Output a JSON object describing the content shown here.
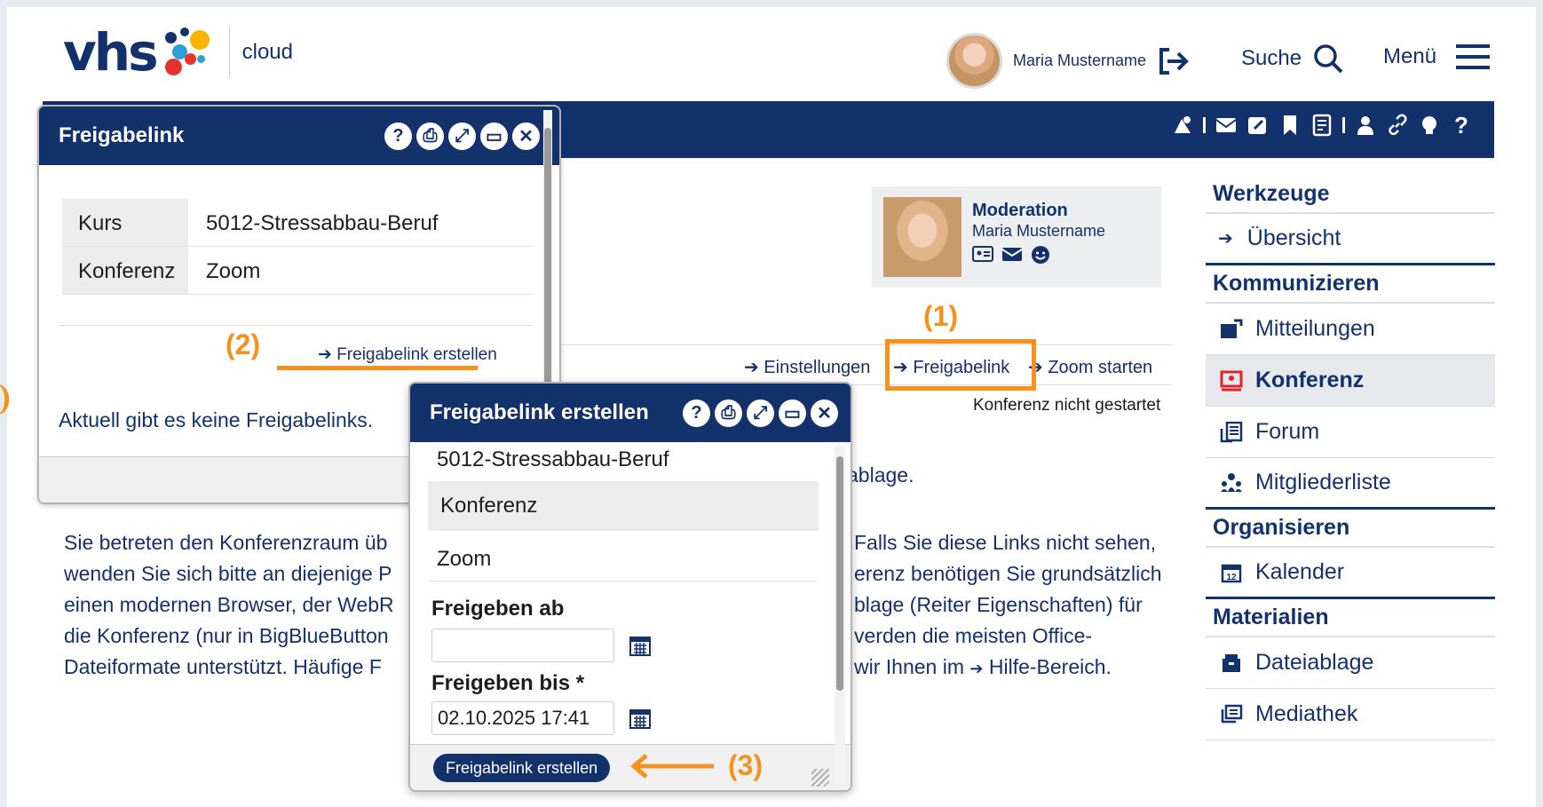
{
  "header": {
    "logo_text": "vhs",
    "logo_sub": "cloud",
    "user_name": "Maria Mustername",
    "search_label": "Suche",
    "menu_label": "Menü"
  },
  "toolbar": {
    "icons": [
      "admin-icon",
      "mail-icon",
      "edit-icon",
      "bookmark-icon",
      "notes-icon",
      "user-icon",
      "link-icon",
      "lightbulb-icon",
      "help-icon"
    ],
    "help_label": "?"
  },
  "sidebar": {
    "sections": [
      {
        "title": "Werkzeuge",
        "items": [
          {
            "label": "Übersicht",
            "icon": "arrow-icon"
          }
        ]
      },
      {
        "title": "Kommunizieren",
        "items": [
          {
            "label": "Mitteilungen",
            "icon": "message-icon"
          },
          {
            "label": "Konferenz",
            "icon": "conference-icon",
            "active": true
          },
          {
            "label": "Forum",
            "icon": "forum-icon"
          },
          {
            "label": "Mitgliederliste",
            "icon": "members-icon"
          }
        ]
      },
      {
        "title": "Organisieren",
        "items": [
          {
            "label": "Kalender",
            "icon": "calendar-icon"
          }
        ]
      },
      {
        "title": "Materialien",
        "items": [
          {
            "label": "Dateiablage",
            "icon": "folder-icon"
          },
          {
            "label": "Mediathek",
            "icon": "media-icon"
          }
        ]
      }
    ]
  },
  "moderation": {
    "title": "Moderation",
    "name": "Maria Mustername"
  },
  "links": {
    "settings": "Einstellungen",
    "share": "Freigabelink",
    "zoom": "Zoom starten",
    "status": "Konferenz nicht gestartet",
    "arrow": "➔"
  },
  "annotations": {
    "a1": "(1)",
    "a2": "(2)",
    "a3": "(3)"
  },
  "body": {
    "fragment_ablage": "ablage.",
    "left_lines": [
      "Sie betreten den Konferenzraum üb",
      "wenden Sie sich bitte an diejenige P",
      "einen modernen Browser, der WebR",
      "die Konferenz (nur in BigBlueButton",
      "Dateiformate unterstützt. Häufige F"
    ],
    "right_lines": [
      "Falls Sie diese Links nicht sehen,",
      "erenz benötigen Sie grundsätzlich",
      "blage (Reiter Eigenschaften) für",
      "verden die meisten Office-",
      "wir Ihnen im"
    ],
    "help_link": "Hilfe-Bereich."
  },
  "dialog1": {
    "title": "Freigabelink",
    "rows": [
      {
        "key": "Kurs",
        "value": "5012-Stressabbau-Beruf"
      },
      {
        "key": "Konferenz",
        "value": "Zoom"
      }
    ],
    "create_link": "Freigabelink erstellen",
    "empty_text": "Aktuell gibt es keine Freigabelinks."
  },
  "dialog2": {
    "title": "Freigabelink erstellen",
    "course": "5012-Stressabbau-Beruf",
    "conf_label": "Konferenz",
    "conf_value": "Zoom",
    "from_label": "Freigeben ab",
    "from_value": "",
    "to_label": "Freigeben bis *",
    "to_value": "02.10.2025 17:41",
    "submit_label": "Freigabelink erstellen"
  },
  "colors": {
    "brand": "#13316b",
    "accent": "#f5921e"
  }
}
